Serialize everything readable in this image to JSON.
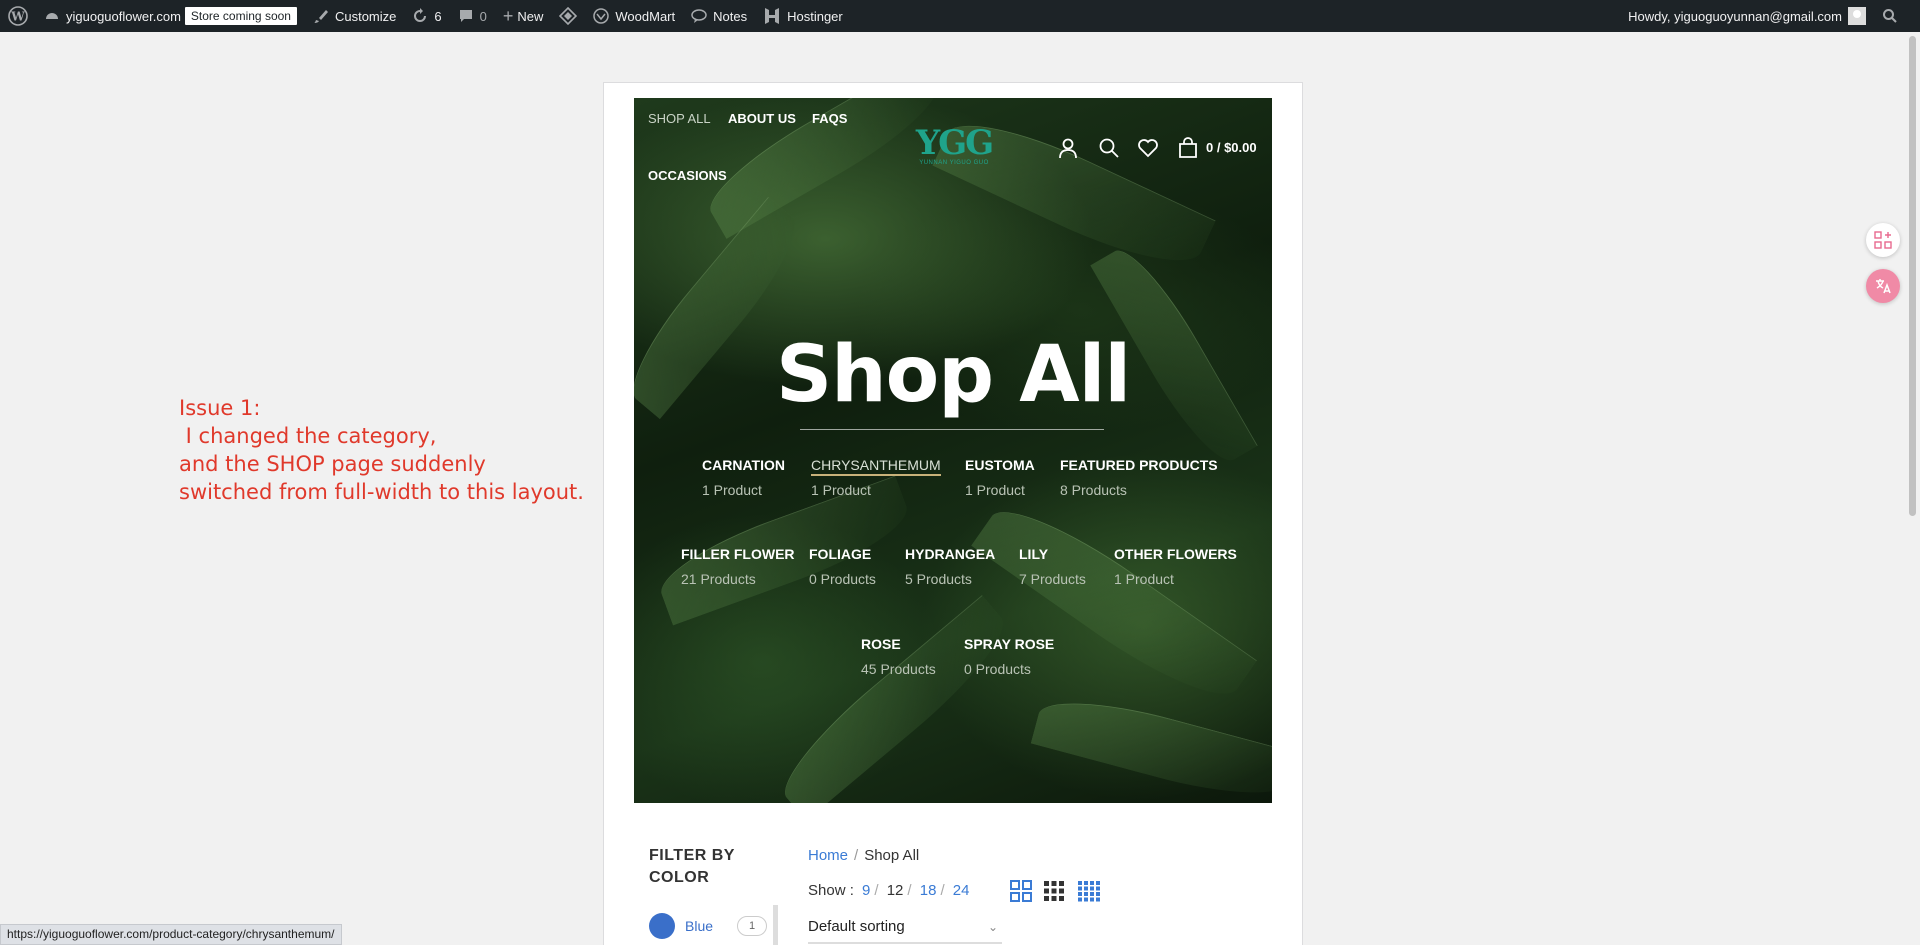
{
  "adminbar": {
    "site_name": "yiguoguoflower.com",
    "store_badge": "Store coming soon",
    "customize": "Customize",
    "updates_count": "6",
    "comments_count": "0",
    "new_label": "New",
    "woodmart": "WoodMart",
    "notes": "Notes",
    "hostinger": "Hostinger",
    "howdy": "Howdy, yiguoguoyunnan@gmail.com"
  },
  "annotation": {
    "text": "Issue 1:\n I changed the category,\nand the SHOP page suddenly\nswitched from full-width to this layout."
  },
  "header": {
    "nav": [
      "SHOP ALL",
      "ABOUT US",
      "FAQS",
      "OCCASIONS"
    ],
    "logo_mark": "YGG",
    "logo_sub": "YUNNAN YIGUO GUO",
    "cart_total": "0 / $0.00"
  },
  "hero": {
    "title": "Shop All",
    "categories": [
      {
        "name": "CARNATION",
        "count": "1 Product"
      },
      {
        "name": "CHRYSANTHEMUM",
        "count": "1 Product"
      },
      {
        "name": "EUSTOMA",
        "count": "1 Product"
      },
      {
        "name": "FEATURED PRODUCTS",
        "count": "8 Products"
      },
      {
        "name": "FILLER FLOWER",
        "count": "21 Products"
      },
      {
        "name": "FOLIAGE",
        "count": "0 Products"
      },
      {
        "name": "HYDRANGEA",
        "count": "5 Products"
      },
      {
        "name": "LILY",
        "count": "7 Products"
      },
      {
        "name": "OTHER FLOWERS",
        "count": "1 Product"
      },
      {
        "name": "ROSE",
        "count": "45 Products"
      },
      {
        "name": "SPRAY ROSE",
        "count": "0 Products"
      }
    ]
  },
  "sidebar": {
    "filter_title": "FILTER BY COLOR",
    "colors": [
      {
        "label": "Blue",
        "count": "1",
        "color": "#3a6fc9"
      }
    ]
  },
  "shop": {
    "breadcrumb_home": "Home",
    "breadcrumb_sep": "/",
    "breadcrumb_current": "Shop All",
    "show_label": "Show :",
    "show_options": [
      "9",
      "12",
      "18",
      "24"
    ],
    "sorting": "Default sorting"
  },
  "status_url": "https://yiguoguoflower.com/product-category/chrysanthemum/",
  "colors": {
    "accent": "#3a7bd5",
    "annotation": "#e0392b",
    "logo": "#1fa38b"
  }
}
